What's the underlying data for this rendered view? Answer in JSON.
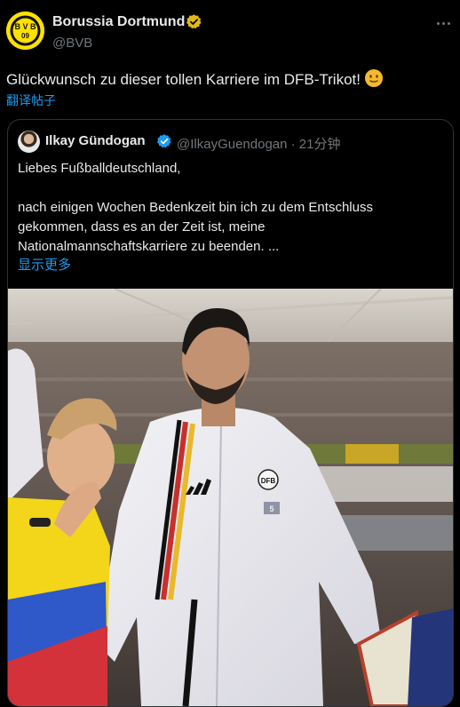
{
  "author": {
    "name": "Borussia Dortmund",
    "handle": "@BVB",
    "avatar_icon": "bvb-logo-icon",
    "badge_icon": "verified-gold-badge-icon"
  },
  "post": {
    "text": "Glückwunsch zu dieser tollen Karriere im DFB-Trikot!",
    "emoji_icon": "slightly-smiling-face-icon",
    "translate_label": "翻译帖子"
  },
  "more_icon": "more-options-icon",
  "quoted": {
    "name": "Ilkay Gündogan",
    "handle_time": "@IlkayGuendogan · 21分钟",
    "badge_icon": "verified-blue-badge-icon",
    "body": [
      "Liebes Fußballdeutschland,",
      "nach einigen Wochen Bedenkzeit bin ich zu dem Entschluss gekommen, dass es an der Zeit ist, meine Nationalmannschaftskarriere zu beenden. ..."
    ],
    "show_more": "显示更多",
    "media": {
      "jersey_number": "5"
    }
  },
  "colors": {
    "accent_link": "#1d9bf0",
    "background": "#000000",
    "bvb_yellow": "#fde100",
    "text_primary": "#e7e9ea",
    "text_secondary": "#71767b"
  }
}
